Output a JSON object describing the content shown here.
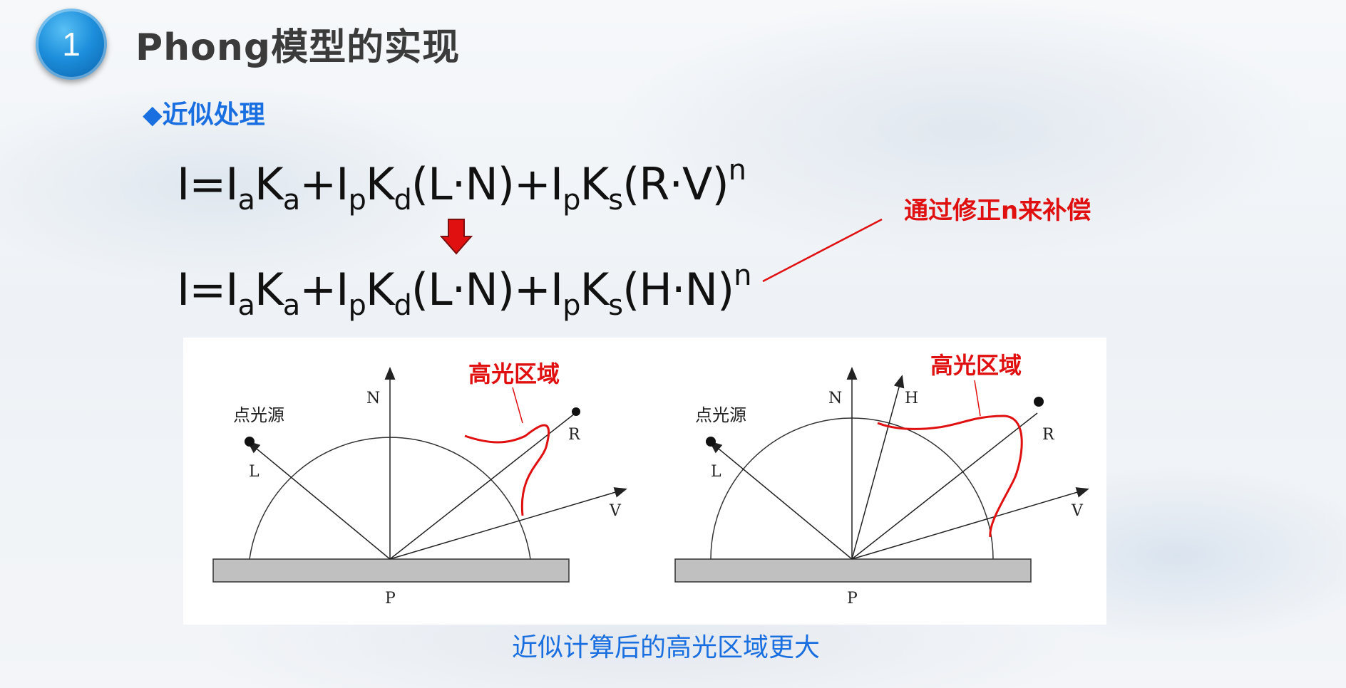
{
  "slide": {
    "number": "1",
    "title": "Phong模型的实现",
    "bullet": "◆近似处理",
    "note": "通过修正n来补偿",
    "caption": "近似计算后的高光区域更大"
  },
  "formula1": {
    "parts": [
      "I=I",
      "a",
      "K",
      "a",
      "+I",
      "p",
      "K",
      "d",
      "(L·N)+I",
      "p",
      "K",
      "s",
      "(R·V)",
      "n"
    ]
  },
  "formula2": {
    "parts": [
      "I=I",
      "a",
      "K",
      "a",
      "+I",
      "p",
      "K",
      "d",
      "(L·N)+I",
      "p",
      "K",
      "s",
      "(H·N)",
      "n"
    ]
  },
  "diagram": {
    "left": {
      "light_label": "点光源",
      "highlight_label": "高光区域",
      "N": "N",
      "L": "L",
      "R": "R",
      "V": "V",
      "P": "P"
    },
    "right": {
      "light_label": "点光源",
      "highlight_label": "高光区域",
      "N": "N",
      "H": "H",
      "L": "L",
      "R": "R",
      "V": "V",
      "P": "P"
    }
  },
  "colors": {
    "accent_blue": "#1a6fe0",
    "highlight_red": "#e01010",
    "arrow_red": "#e01010"
  }
}
